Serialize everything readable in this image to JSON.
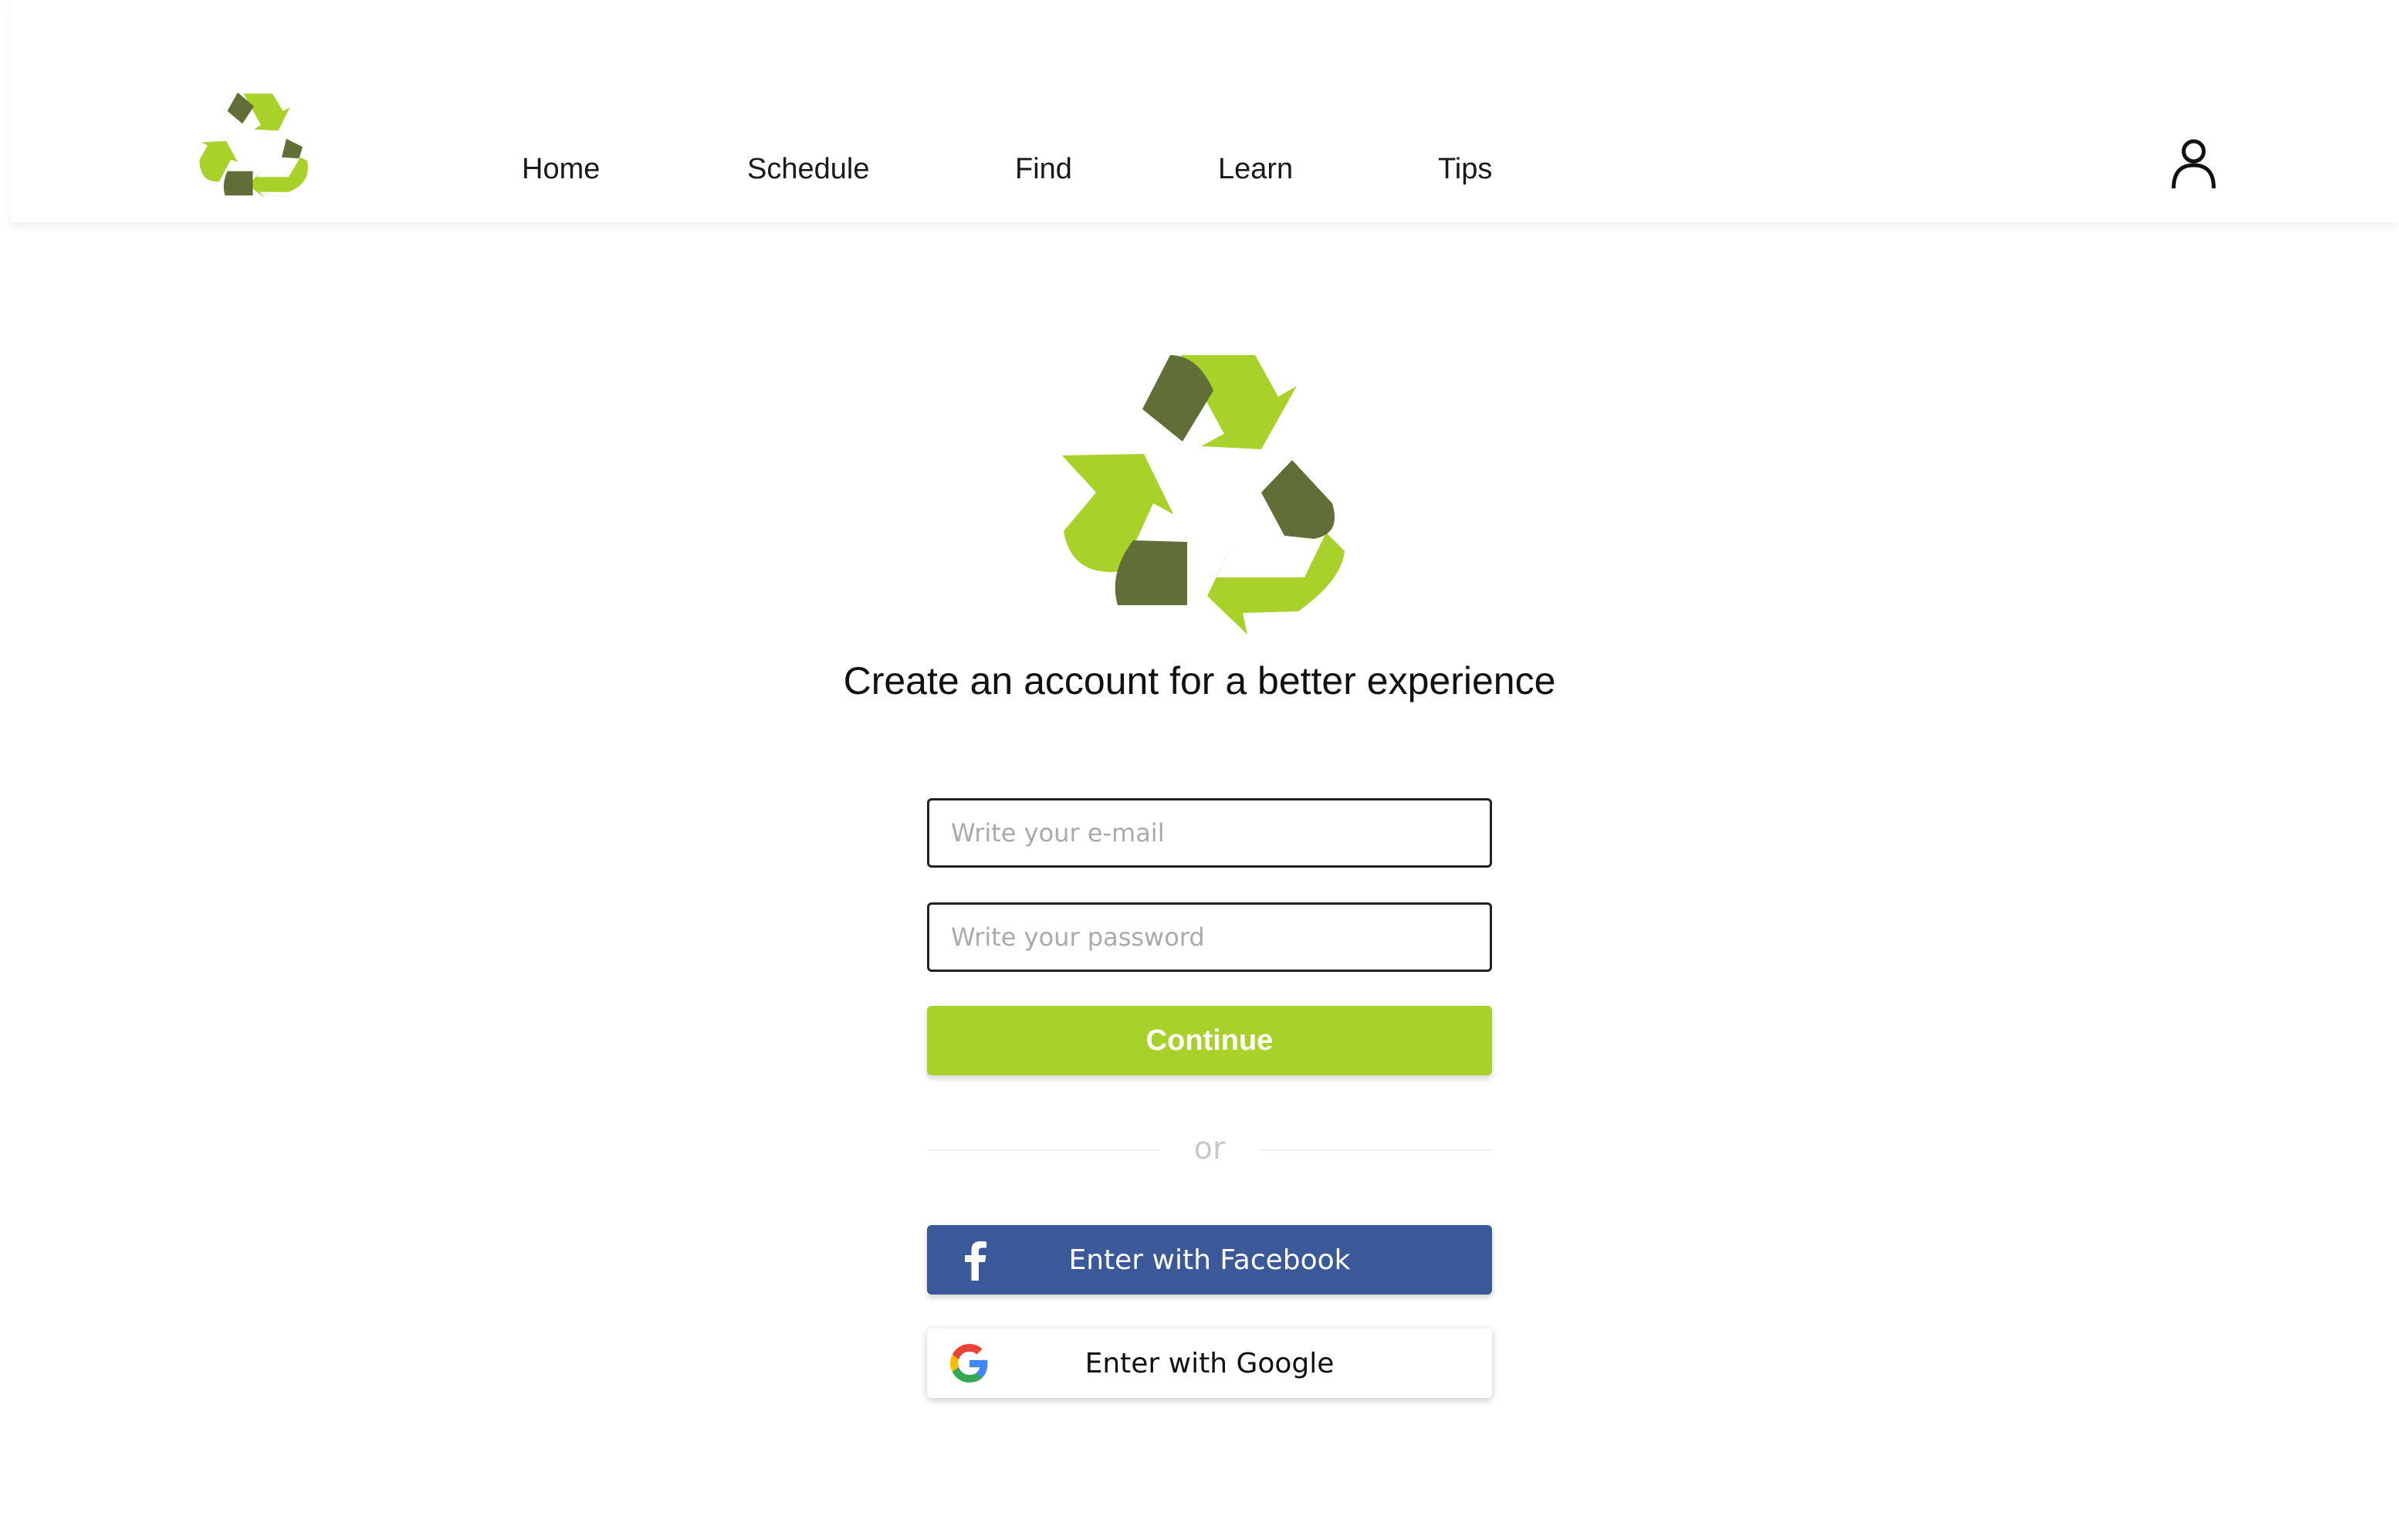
{
  "colors": {
    "brand_light_green": "#a8d12a",
    "brand_dark_green": "#606f37",
    "facebook_blue": "#3b5998",
    "text_dark": "#111111"
  },
  "header": {
    "logo": "recycle-logo-icon",
    "nav": [
      {
        "label": "Home"
      },
      {
        "label": "Schedule"
      },
      {
        "label": "Find"
      },
      {
        "label": "Learn"
      },
      {
        "label": "Tips"
      }
    ],
    "user_icon": "user-icon"
  },
  "main": {
    "logo": "recycle-logo-icon",
    "title": "Create an account for a better experience",
    "email": {
      "placeholder": "Write your e-mail",
      "value": ""
    },
    "password": {
      "placeholder": "Write your password",
      "value": ""
    },
    "continue_label": "Continue",
    "divider_text": "or",
    "facebook_label": "Enter with Facebook",
    "facebook_icon": "facebook-icon",
    "google_label": "Enter with Google",
    "google_icon": "google-icon"
  }
}
